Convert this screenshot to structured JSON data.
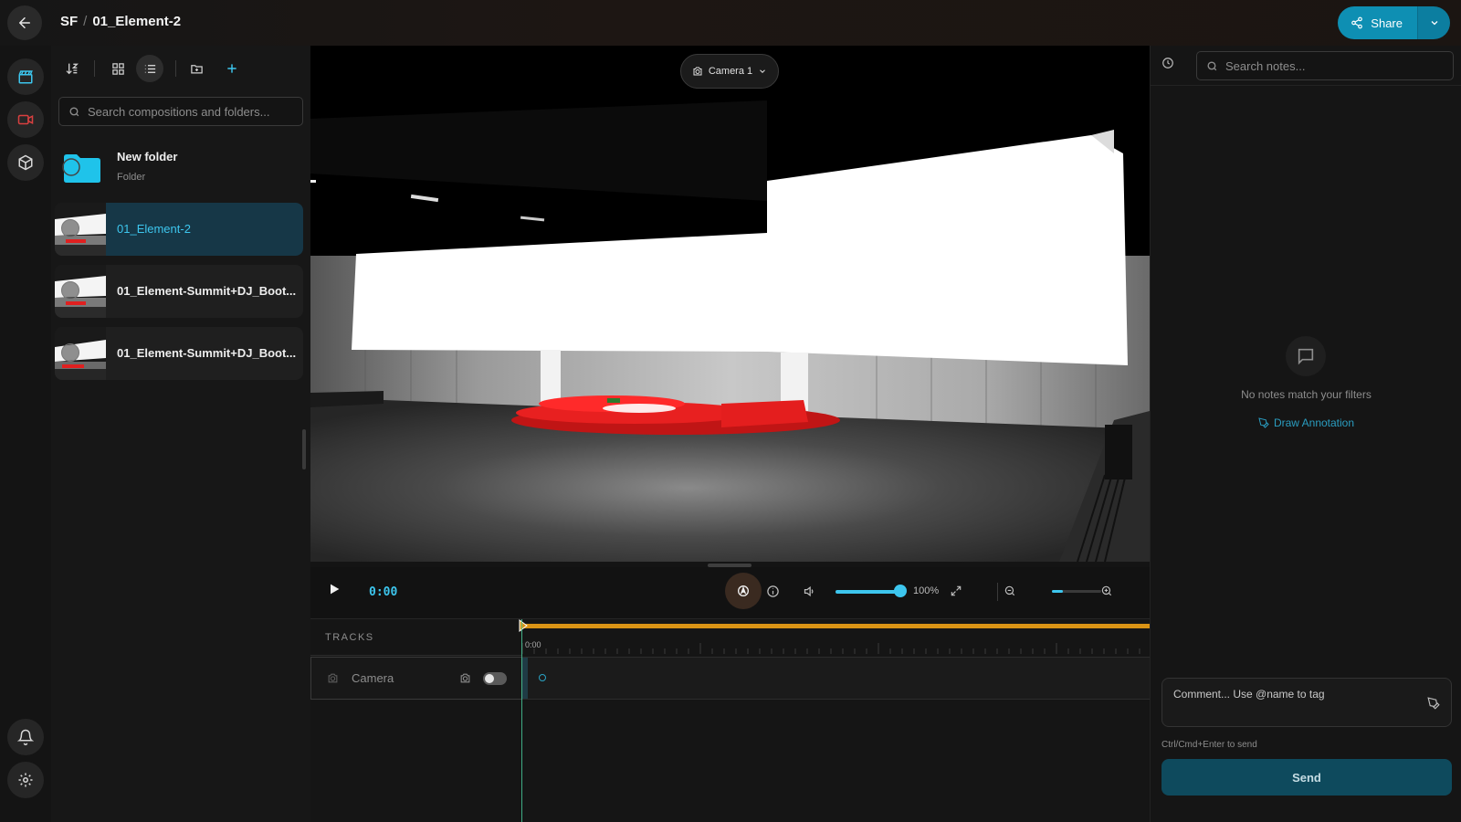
{
  "header": {
    "breadcrumb_root": "SF",
    "separator": "/",
    "title": "01_Element-2",
    "share_label": "Share"
  },
  "sidebar": {
    "search_placeholder": "Search compositions and folders...",
    "view_mode": "list",
    "folder": {
      "name": "New folder",
      "type": "Folder"
    },
    "items": [
      {
        "label": "01_Element-2",
        "selected": true
      },
      {
        "label": "01_Element-Summit+DJ_Boot...",
        "selected": false
      },
      {
        "label": "01_Element-Summit+DJ_Boot...",
        "selected": false
      }
    ]
  },
  "viewport": {
    "camera_label": "Camera 1"
  },
  "player": {
    "timecode": "0:00",
    "volume_label": "100%",
    "volume_level": 1.0,
    "zoom_level": 0.2
  },
  "timeline": {
    "tracks_label": "TRACKS",
    "ruler_start": "0:00",
    "tracks": [
      {
        "name": "Camera",
        "enabled": false
      }
    ]
  },
  "notes": {
    "search_placeholder": "Search notes...",
    "empty_text": "No notes match your filters",
    "draw_annotation_label": "Draw Annotation",
    "comment_placeholder": "Comment... Use @name to tag",
    "send_hint": "Ctrl/Cmd+Enter to send",
    "send_label": "Send"
  },
  "colors": {
    "accent": "#3dc6ee",
    "share_button": "#0e8fb3",
    "timeline_bar": "#d99315",
    "send_button": "#0e4a5d"
  }
}
